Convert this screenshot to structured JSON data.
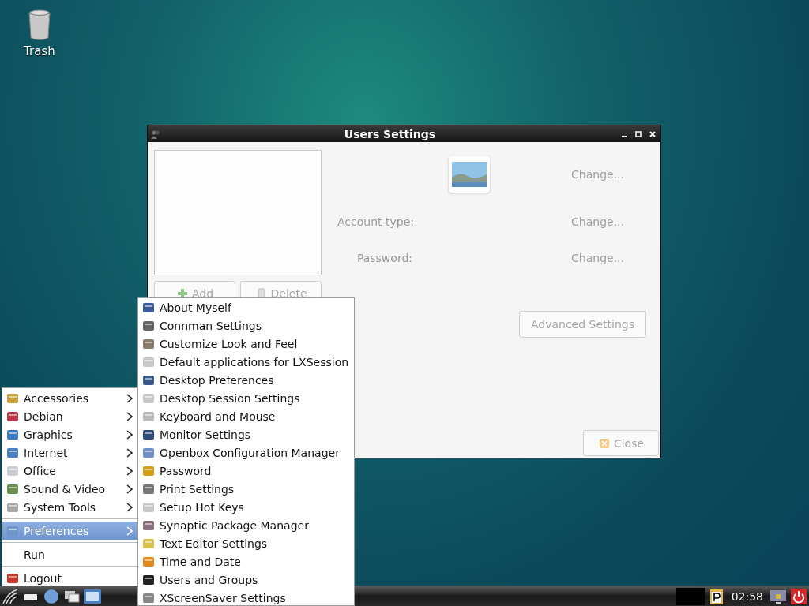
{
  "desktop": {
    "icons": [
      {
        "label": "Trash"
      }
    ]
  },
  "window": {
    "title": "Users Settings",
    "add_button": {
      "label": "Add",
      "disabled": true
    },
    "delete_button": {
      "label": "Delete",
      "disabled": true
    },
    "rows": [
      {
        "kind": "avatar",
        "change": "Change..."
      },
      {
        "kind": "field",
        "label": "Account type:",
        "change": "Change..."
      },
      {
        "kind": "field",
        "label": "Password:",
        "change": "Change..."
      }
    ],
    "advanced_button": {
      "label": "Advanced Settings",
      "disabled": true
    },
    "close_button": {
      "label": "Close",
      "disabled": true
    }
  },
  "main_menu": {
    "items": [
      {
        "kind": "submenu",
        "label": "Accessories",
        "selected": false
      },
      {
        "kind": "submenu",
        "label": "Debian",
        "selected": false
      },
      {
        "kind": "submenu",
        "label": "Graphics",
        "selected": false
      },
      {
        "kind": "submenu",
        "label": "Internet",
        "selected": false
      },
      {
        "kind": "submenu",
        "label": "Office",
        "selected": false
      },
      {
        "kind": "submenu",
        "label": "Sound & Video",
        "selected": false
      },
      {
        "kind": "submenu",
        "label": "System Tools",
        "selected": false
      },
      {
        "kind": "separator"
      },
      {
        "kind": "submenu",
        "label": "Preferences",
        "selected": true
      },
      {
        "kind": "separator"
      },
      {
        "kind": "plain",
        "label": "Run",
        "selected": false
      },
      {
        "kind": "separator"
      },
      {
        "kind": "action",
        "label": "Logout",
        "selected": false
      }
    ]
  },
  "submenu": {
    "items": [
      {
        "label": "About Myself"
      },
      {
        "label": "Connman Settings"
      },
      {
        "label": "Customize Look and Feel"
      },
      {
        "label": "Default applications for LXSession"
      },
      {
        "label": "Desktop Preferences"
      },
      {
        "label": "Desktop Session Settings"
      },
      {
        "label": "Keyboard and Mouse"
      },
      {
        "label": "Monitor Settings"
      },
      {
        "label": "Openbox Configuration Manager"
      },
      {
        "label": "Password"
      },
      {
        "label": "Print Settings"
      },
      {
        "label": "Setup Hot Keys"
      },
      {
        "label": "Synaptic Package Manager"
      },
      {
        "label": "Text Editor Settings"
      },
      {
        "label": "Time and Date"
      },
      {
        "label": "Users and Groups"
      },
      {
        "label": "XScreenSaver Settings"
      }
    ]
  },
  "taskbar": {
    "clock": "02:58"
  }
}
